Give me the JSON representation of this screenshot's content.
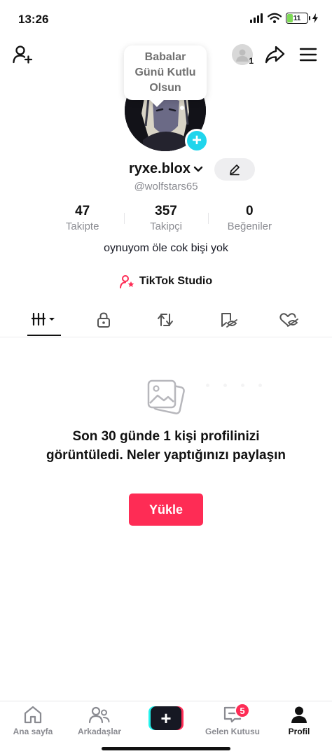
{
  "status_bar": {
    "time": "13:26",
    "battery_level": "11",
    "battery_color": "#7ed957"
  },
  "top_nav": {
    "account_count": "1"
  },
  "note": {
    "text": "Babalar Günü Kutlu Olsun"
  },
  "profile": {
    "username": "ryxe.blox",
    "handle": "@wolfstars65",
    "bio": "oynuyom öle cok bişi yok"
  },
  "stats": [
    {
      "value": "47",
      "label": "Takipte"
    },
    {
      "value": "357",
      "label": "Takipçi"
    },
    {
      "value": "0",
      "label": "Beğeniler"
    }
  ],
  "studio": {
    "label": "TikTok Studio"
  },
  "tabs": [
    {
      "icon": "grid-icon",
      "active": true
    },
    {
      "icon": "lock-icon",
      "active": false
    },
    {
      "icon": "repost-icon",
      "active": false
    },
    {
      "icon": "bookmark-icon",
      "active": false
    },
    {
      "icon": "liked-icon",
      "active": false
    }
  ],
  "empty_state": {
    "message": "Son 30 günde 1 kişi profilinizi görüntüledi. Neler yaptığınızı paylaşın",
    "button_label": "Yükle"
  },
  "bottom_nav": {
    "items": [
      {
        "label": "Ana sayfa",
        "icon": "home-icon"
      },
      {
        "label": "Arkadaşlar",
        "icon": "friends-icon"
      },
      {
        "label": "",
        "icon": "plus-icon"
      },
      {
        "label": "Gelen Kutusu",
        "icon": "inbox-icon",
        "badge": "5"
      },
      {
        "label": "Profil",
        "icon": "profile-icon",
        "active": true
      }
    ]
  },
  "colors": {
    "accent": "#fe2c55",
    "cyan": "#25f4ee",
    "text": "#161823",
    "muted": "#8a8b91"
  }
}
